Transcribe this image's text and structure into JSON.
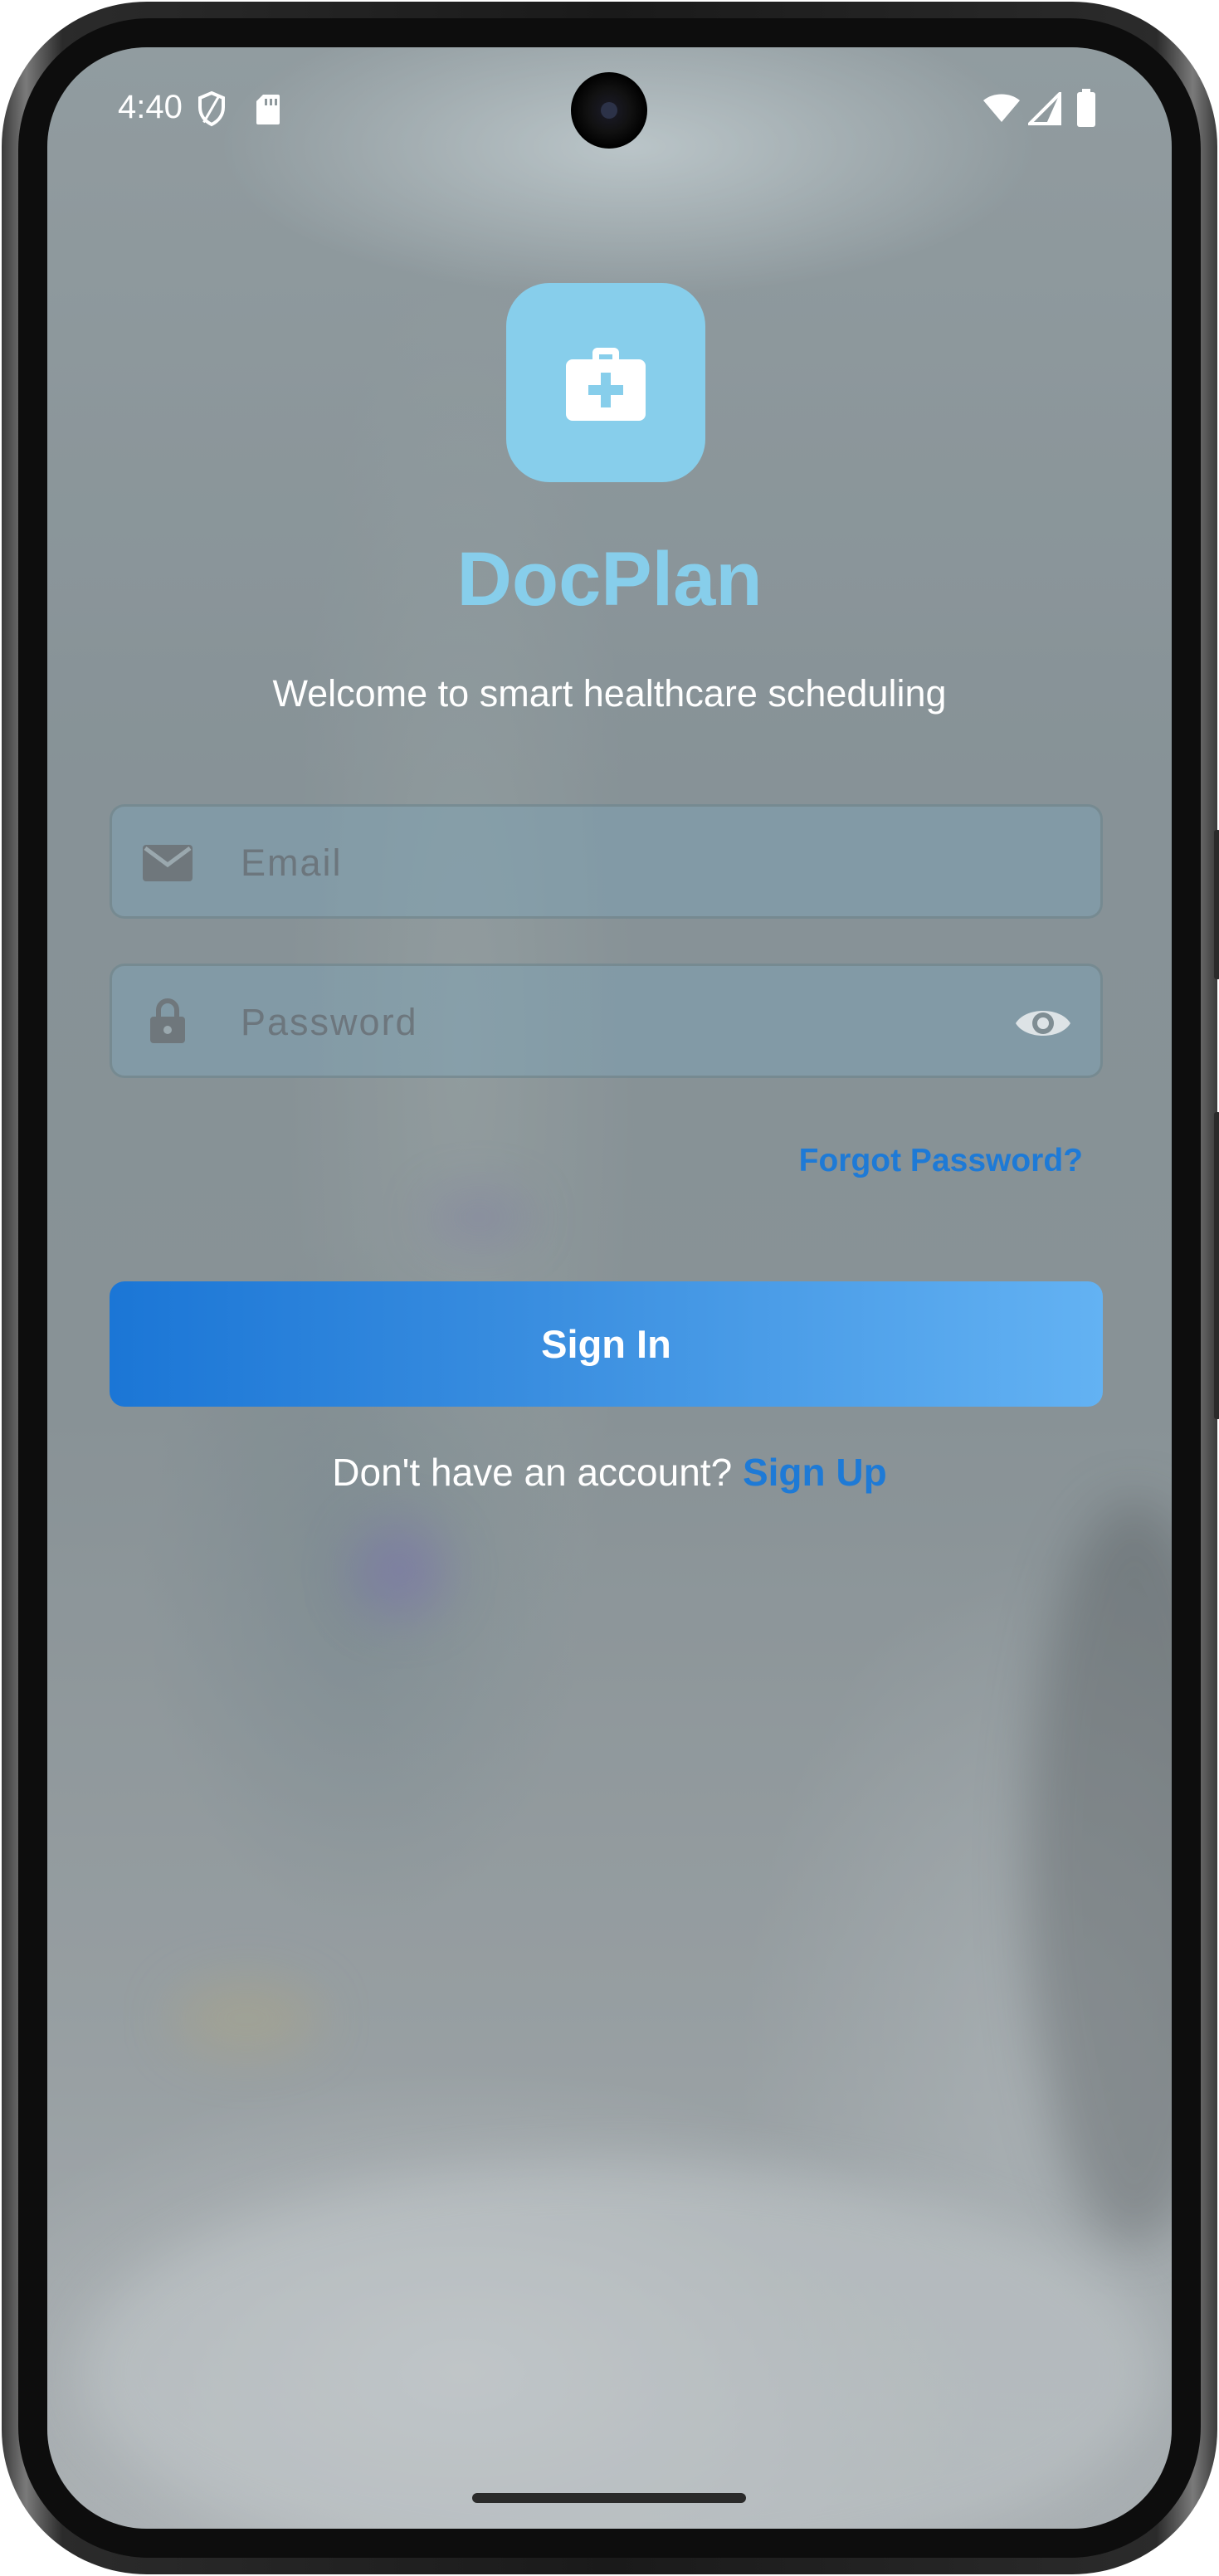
{
  "status_bar": {
    "time": "4:40",
    "icons": [
      "shield-icon",
      "sd-card-icon",
      "wifi-icon",
      "signal-icon",
      "battery-icon"
    ]
  },
  "app": {
    "logo_icon": "medical-kit-icon",
    "title": "DocPlan",
    "subtitle": "Welcome to smart healthcare scheduling",
    "brand_color": "#87ceeb",
    "link_color": "#1e7ad6"
  },
  "form": {
    "email": {
      "icon": "mail-icon",
      "placeholder": "Email",
      "value": ""
    },
    "password": {
      "icon": "lock-icon",
      "placeholder": "Password",
      "value": "",
      "toggle_icon": "eye-icon"
    },
    "forgot_password_label": "Forgot Password?",
    "sign_in_label": "Sign In"
  },
  "signup": {
    "prompt": "Don't have an account?",
    "link_label": "Sign Up"
  }
}
